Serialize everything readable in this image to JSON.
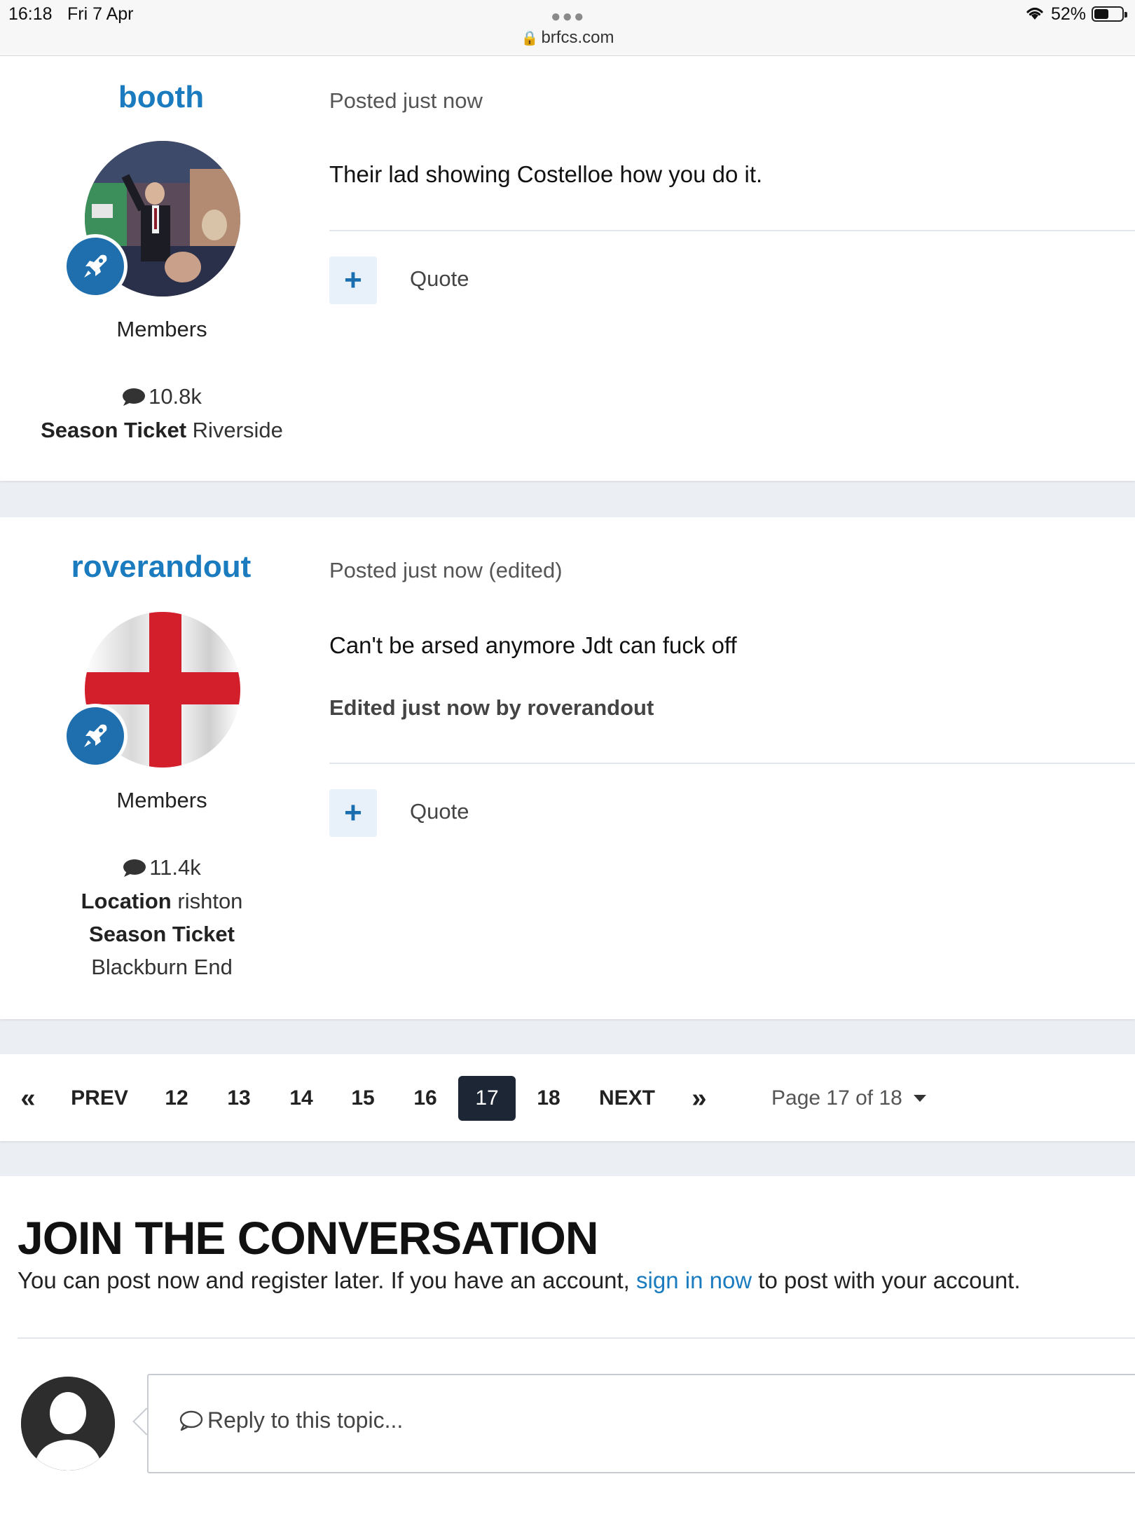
{
  "status_bar": {
    "time": "16:18",
    "date": "Fri 7 Apr",
    "url": "brfcs.com",
    "battery": "52%"
  },
  "posts": [
    {
      "author": "booth",
      "group": "Members",
      "post_count": "10.8k",
      "fields": [
        {
          "label": "Season Ticket",
          "value": "Riverside"
        }
      ],
      "meta": "Posted just now",
      "content": "Their lad showing Costelloe how you do it.",
      "quote_label": "Quote"
    },
    {
      "author": "roverandout",
      "group": "Members",
      "post_count": "11.4k",
      "fields": [
        {
          "label": "Location",
          "value": "rishton"
        },
        {
          "label": "Season Ticket",
          "value": "Blackburn End"
        }
      ],
      "meta": "Posted just now (edited)",
      "content": "Can't be arsed anymore  Jdt can fuck off",
      "edited_note": "Edited just now by roverandout",
      "quote_label": "Quote"
    }
  ],
  "pagination": {
    "first": "«",
    "prev": "PREV",
    "pages": [
      "12",
      "13",
      "14",
      "15",
      "16",
      "17",
      "18"
    ],
    "current": "17",
    "next": "NEXT",
    "last": "»",
    "page_jump": "Page 17 of 18"
  },
  "join": {
    "title": "JOIN THE CONVERSATION",
    "text_before": "You can post now and register later. If you have an account, ",
    "link_text": "sign in now",
    "text_after": " to post with your account.",
    "reply_placeholder": "Reply to this topic..."
  },
  "colors": {
    "accent": "#1a7bbf",
    "badge": "#1f6fae",
    "active_page": "#1d2634"
  }
}
